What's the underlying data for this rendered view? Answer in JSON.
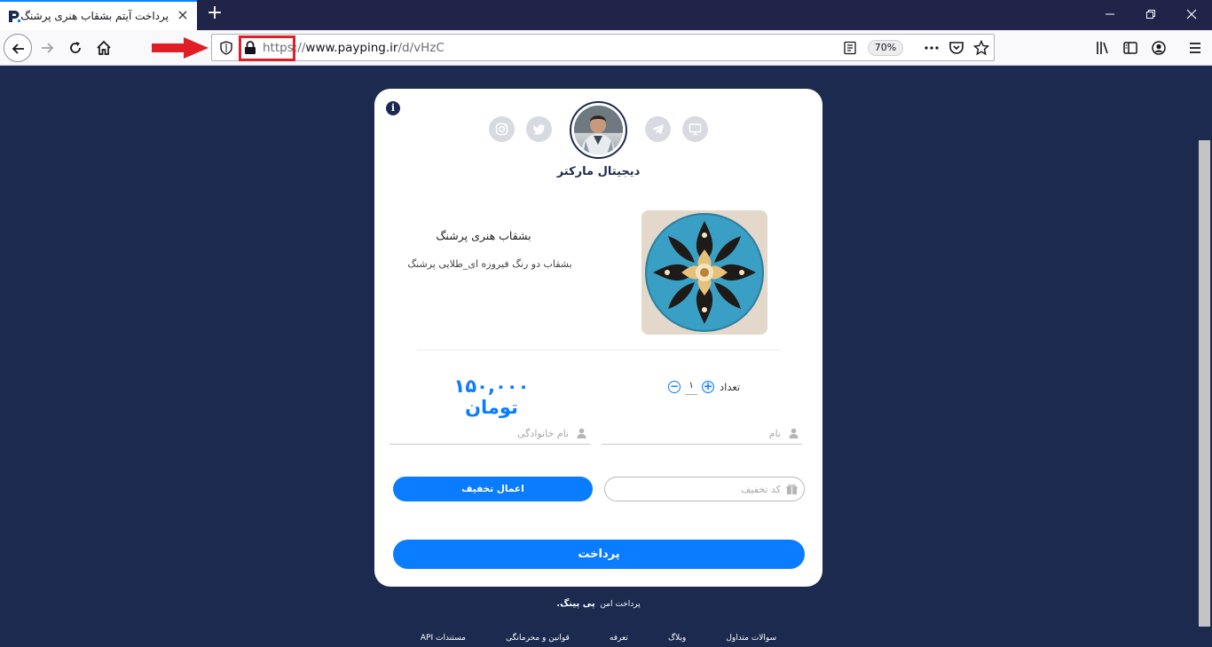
{
  "browser": {
    "tab_title": "پرداخت آیتم بشقاب هنری پرشنگ",
    "url_scheme": "https",
    "url_sep": "://",
    "url_host": "www.payping.ir",
    "url_path": "/d/vHzC",
    "zoom": "70%",
    "accent": "#0a84ff",
    "highlight_color": "#e11d25"
  },
  "page": {
    "seller_name": "دیجیتال مارکتر",
    "product": {
      "name": "بشقاب هنری پرشنگ",
      "description": "بشقاب دو رنگ فیروزه ای_طلایی پرشنگ"
    },
    "quantity": {
      "label": "تعداد",
      "value": "۱",
      "plus": "+",
      "minus": "−"
    },
    "price": "۱۵۰,۰۰۰ تومان",
    "form": {
      "first_name_placeholder": "نام",
      "last_name_placeholder": "نام خانوادگی",
      "coupon_placeholder": "کد تخفیف",
      "apply_label": "اعمال تخفیف",
      "pay_label": "پرداخت"
    },
    "info_icon": "i",
    "social_icons": [
      "instagram-icon",
      "twitter-icon",
      "telegram-icon",
      "website-icon"
    ],
    "brand_color": "#0a7cff",
    "background": "#1b2a4e"
  },
  "footer": {
    "secure_text": "پرداخت امن",
    "brand": "پی پینگ",
    "links": [
      "سوالات متداول",
      "وبلاگ",
      "تعرفه",
      "قوانین و محرمانگی",
      "مستندات API"
    ]
  }
}
